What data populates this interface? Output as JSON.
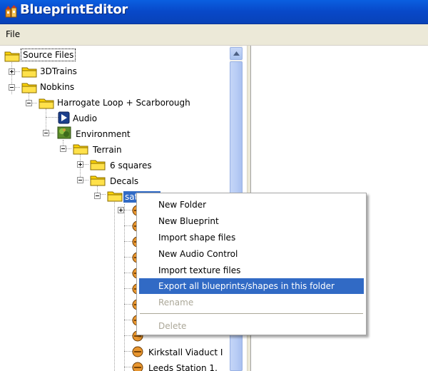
{
  "window": {
    "title": "BlueprintEditor",
    "title_bar_color": "#0848c8"
  },
  "menu": {
    "file_label": "File"
  },
  "tree": {
    "nodes": [
      {
        "label": "Source Files",
        "icon": "folder-icon"
      },
      {
        "label": "3DTrains",
        "icon": "folder-icon"
      },
      {
        "label": "Nobkins",
        "icon": "folder-icon"
      },
      {
        "label": "Harrogate Loop + Scarborough",
        "icon": "folder-icon"
      },
      {
        "label": "Audio",
        "icon": "audio-icon"
      },
      {
        "label": "Environment",
        "icon": "environment-icon"
      },
      {
        "label": "Terrain",
        "icon": "folder-icon"
      },
      {
        "label": "6 squares",
        "icon": "folder-icon"
      },
      {
        "label": "Decals",
        "icon": "folder-icon"
      },
      {
        "label": "satellite",
        "icon": "folder-icon"
      },
      {
        "label": "Kirkstall Viaduct I",
        "icon": "blueprint-icon"
      },
      {
        "label": "Leeds Station 1,",
        "icon": "blueprint-icon"
      }
    ],
    "selected_color": "#316ac5"
  },
  "context_menu": {
    "items": [
      {
        "label": "New Folder",
        "state": "normal"
      },
      {
        "label": "New Blueprint",
        "state": "normal"
      },
      {
        "label": "Import shape files",
        "state": "normal"
      },
      {
        "label": "New Audio Control",
        "state": "normal"
      },
      {
        "label": "Import texture files",
        "state": "normal"
      },
      {
        "label": "Export all blueprints/shapes in this folder",
        "state": "highlighted"
      },
      {
        "label": "Rename",
        "state": "disabled"
      },
      {
        "label": "Delete",
        "state": "disabled"
      }
    ],
    "highlight_color": "#316ac5",
    "disabled_color": "#aca899"
  }
}
